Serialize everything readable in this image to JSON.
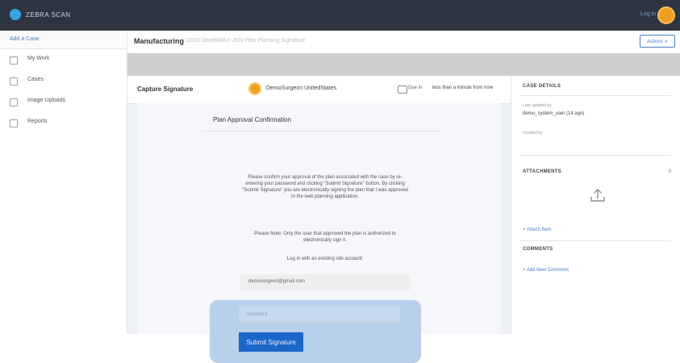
{
  "topbar": {
    "brand": "ZEBRA SCAN",
    "right_link": "Log in",
    "logo_icon": "app-logo-icon",
    "avatar_color": "#f0a020"
  },
  "sidebar": {
    "add_case": "Add a Case",
    "items": [
      {
        "label": "My Work",
        "icon": "inbox-icon"
      },
      {
        "label": "Cases",
        "icon": "folder-icon"
      },
      {
        "label": "Image Uploads",
        "icon": "image-icon"
      },
      {
        "label": "Reports",
        "icon": "chart-icon"
      }
    ]
  },
  "header": {
    "breadcrumb_main": "Manufacturing",
    "breadcrumb_sub": "(2018-DentRMAX-J60) Plan Planning Signature",
    "actions": "Actions ∨"
  },
  "main": {
    "capture_title": "Capture Signature",
    "user_name": "DemoSurgeon UnitedStates",
    "due_label": "Due in",
    "due_time": "less than a minute from now",
    "card_title": "Plan Approval Confirmation",
    "paragraph": "Please confirm your approval of the plan associated with the case by re-entering your password and clicking \"Submit Signature\" button. By clicking \"Submit Signature\" you are electronically signing the plan that I was approved in the web planning application.",
    "note": "Please Note: Only the user that approved the plan is authorized to electronically sign it.",
    "login_line": "Log in with an existing site account:",
    "email": "demosurgeon@gmail.com",
    "password_placeholder": "Password",
    "submit": "Submit Signature",
    "accent": "#1c66c8"
  },
  "right": {
    "case_details": "CASE DETAILS",
    "created_label": "Last updated by",
    "created_value": "demo_system_user (14 ago)",
    "status_label": "Created by",
    "attachments": "ATTACHMENTS",
    "attachments_count": "0",
    "upload_icon": "upload-icon",
    "attach_link": "+ Attach Item",
    "comments": "COMMENTS",
    "add_comment": "+ Add New Comment"
  }
}
